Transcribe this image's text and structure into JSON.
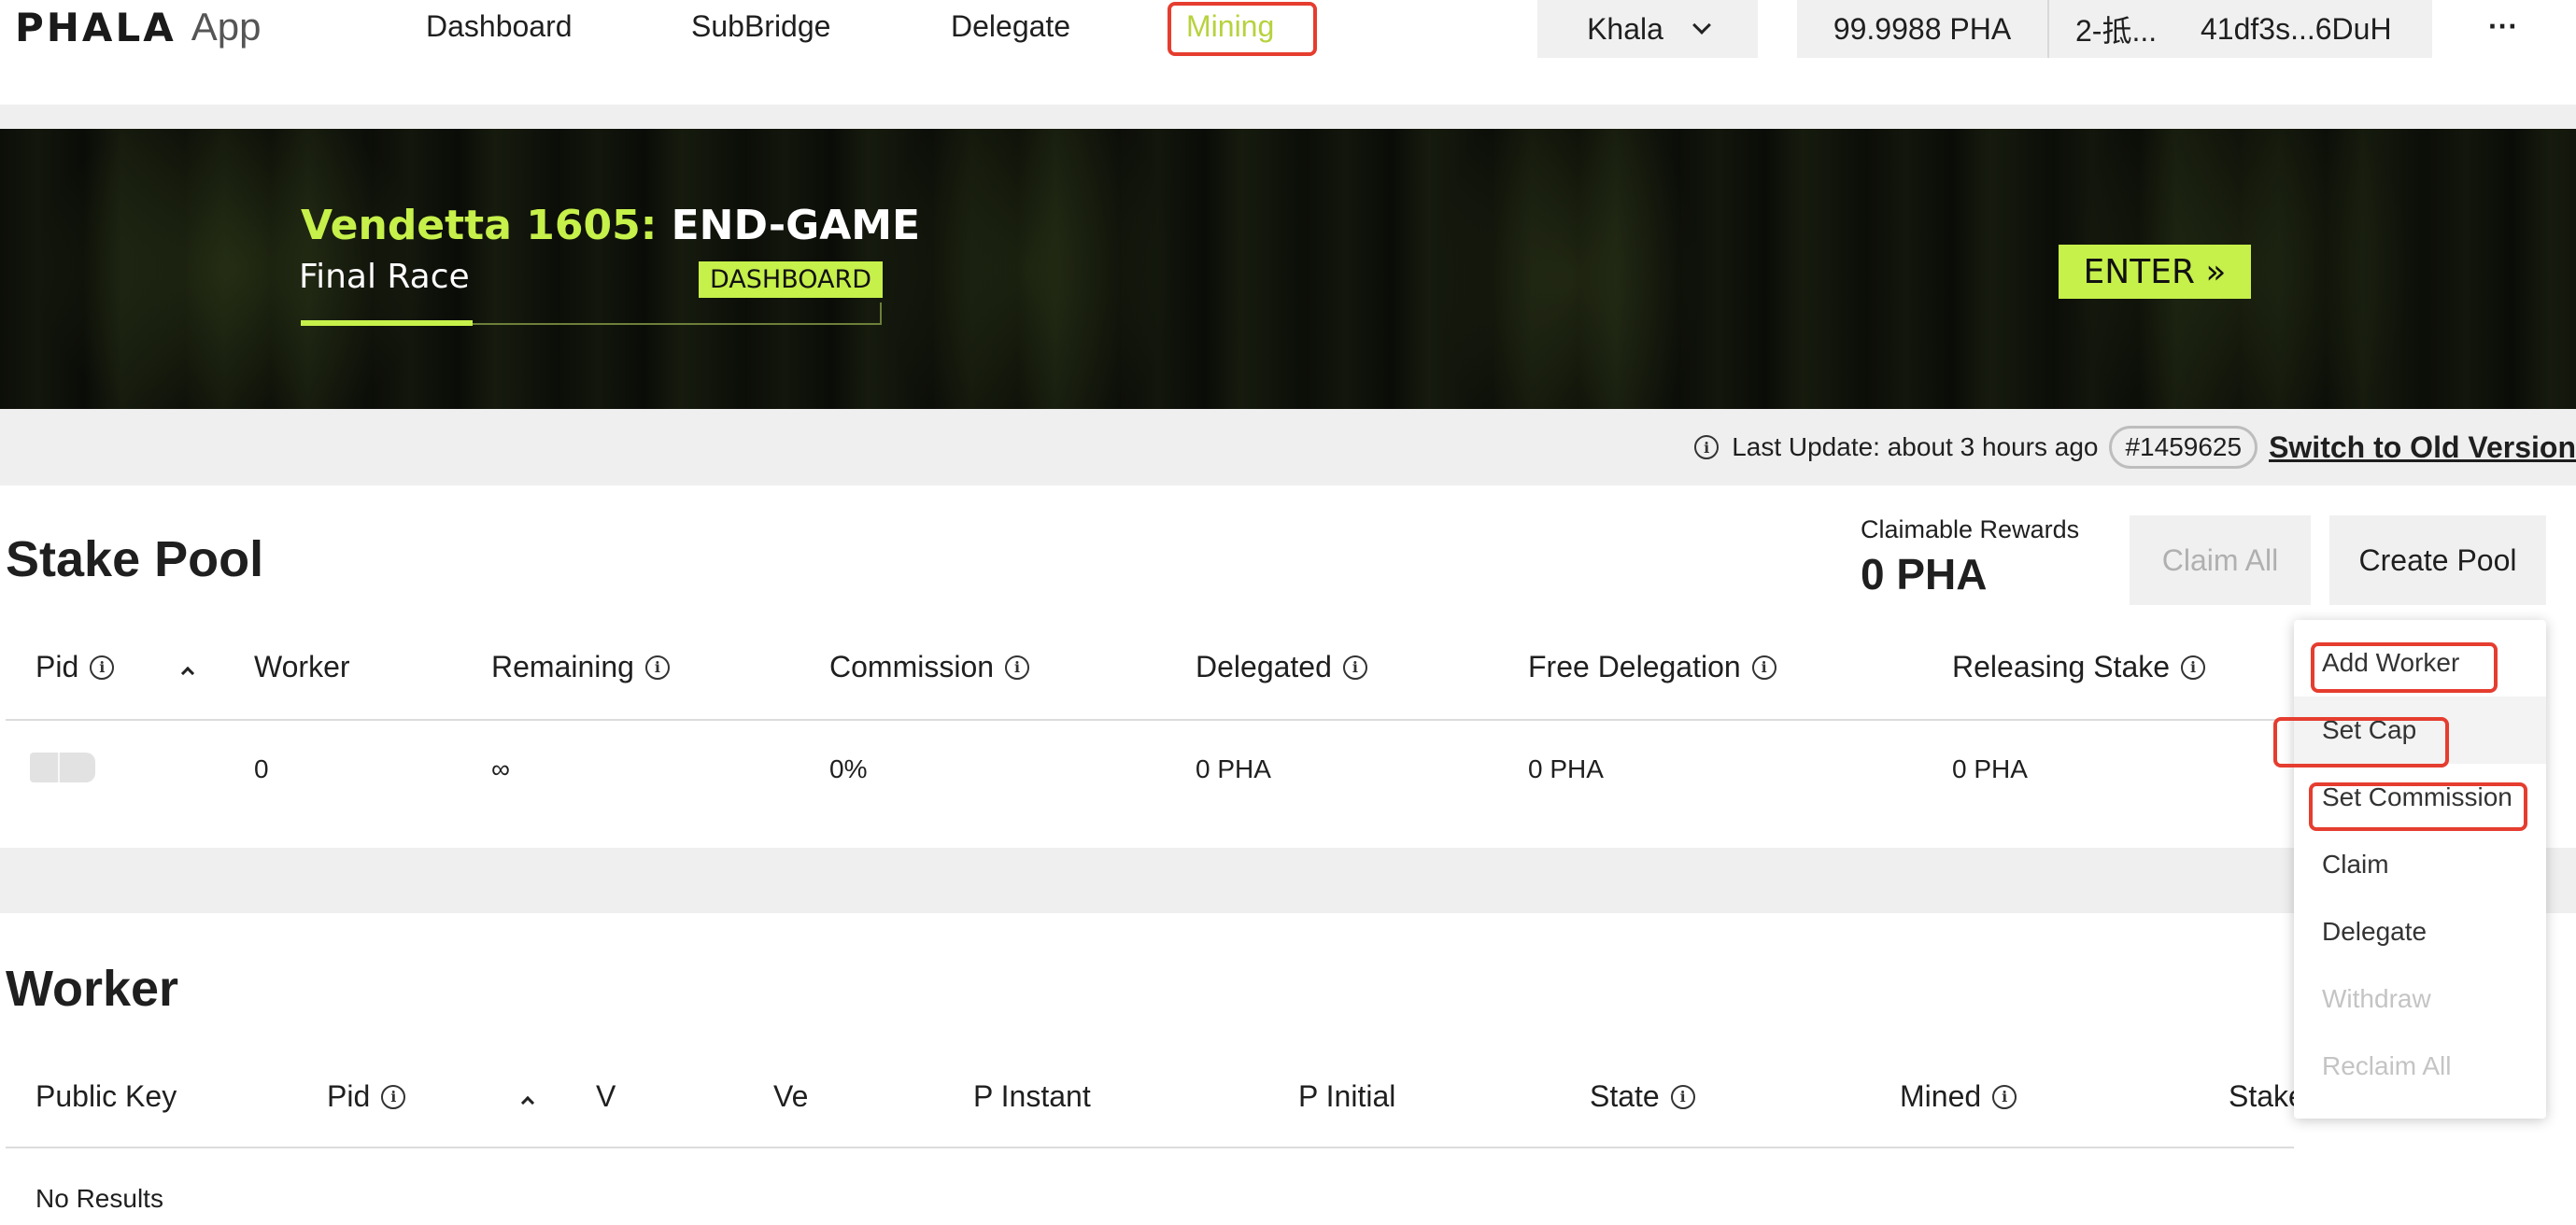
{
  "brand": {
    "logo": "PHALA",
    "app": "App"
  },
  "nav": {
    "dashboard": "Dashboard",
    "subbridge": "SubBridge",
    "delegate": "Delegate",
    "mining": "Mining"
  },
  "header": {
    "chain": "Khala",
    "balance": "99.9988 PHA",
    "account_name": "2-抵...",
    "account_address": "41df3s...6DuH",
    "more": "···"
  },
  "banner": {
    "title_accent": "Vendetta 1605:",
    "title_rest": "END-GAME",
    "subtitle": "Final Race",
    "tag": "DASHBOARD",
    "enter": "ENTER »"
  },
  "status": {
    "last_update": "Last Update: about 3 hours ago",
    "block": "#1459625",
    "switch": "Switch to Old Version"
  },
  "stake_pool": {
    "title": "Stake Pool",
    "claimable_label": "Claimable Rewards",
    "claimable_value": "0 PHA",
    "claim_all": "Claim All",
    "create_pool": "Create Pool",
    "columns": {
      "pid": "Pid",
      "worker": "Worker",
      "remaining": "Remaining",
      "commission": "Commission",
      "delegated": "Delegated",
      "free_delegation": "Free Delegation",
      "releasing_stake": "Releasing Stake"
    },
    "row": {
      "worker": "0",
      "remaining": "∞",
      "commission": "0%",
      "delegated": "0 PHA",
      "free_delegation": "0 PHA",
      "releasing_stake": "0 PHA"
    }
  },
  "worker": {
    "title": "Worker",
    "columns": {
      "public_key": "Public Key",
      "pid": "Pid",
      "v": "V",
      "ve": "Ve",
      "p_instant": "P Instant",
      "p_initial": "P Initial",
      "state": "State",
      "mined": "Mined",
      "stake": "Stake"
    },
    "empty": "No Results"
  },
  "menu": {
    "add_worker": "Add Worker",
    "set_cap": "Set Cap",
    "set_commission": "Set Commission",
    "claim": "Claim",
    "delegate": "Delegate",
    "withdraw": "Withdraw",
    "reclaim_all": "Reclaim All"
  },
  "colors": {
    "accent": "#c6f04a",
    "mining_nav": "#b7d23f",
    "highlight_box": "#e53d2f"
  }
}
